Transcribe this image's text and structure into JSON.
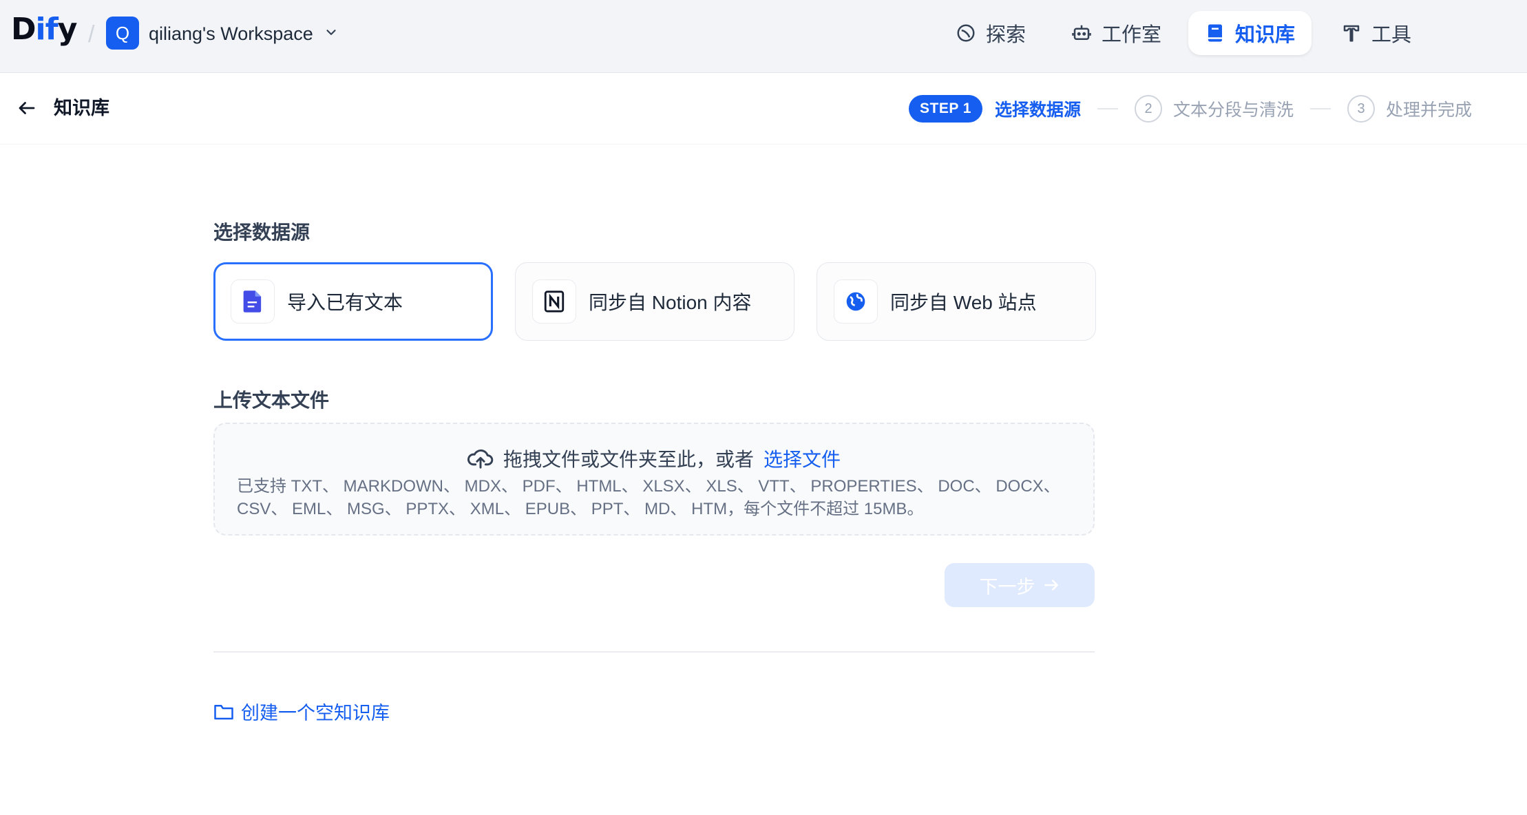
{
  "app": {
    "logo_main": "D",
    "logo_accent": "ify",
    "logo_end": "y"
  },
  "workspace": {
    "avatar": "Q",
    "name": "qiliang's Workspace"
  },
  "nav": [
    {
      "label": "探索",
      "icon": "compass-icon"
    },
    {
      "label": "工作室",
      "icon": "robot-icon"
    },
    {
      "label": "知识库",
      "icon": "book-icon",
      "active": true
    },
    {
      "label": "工具",
      "icon": "hammer-icon"
    }
  ],
  "subheader": {
    "title": "知识库",
    "steps": [
      {
        "badge": "STEP 1",
        "label": "选择数据源",
        "active": true
      },
      {
        "badge": "2",
        "label": "文本分段与清洗"
      },
      {
        "badge": "3",
        "label": "处理并完成"
      }
    ]
  },
  "datasource": {
    "title": "选择数据源",
    "options": [
      {
        "label": "导入已有文本",
        "icon": "file-text-icon",
        "selected": true
      },
      {
        "label": "同步自 Notion 内容",
        "icon": "notion-icon"
      },
      {
        "label": "同步自 Web 站点",
        "icon": "globe-icon"
      }
    ]
  },
  "upload": {
    "title": "上传文本文件",
    "drop_text": "拖拽文件或文件夹至此，或者",
    "select_link": "选择文件",
    "formats_line1": "已支持 TXT、 MARKDOWN、 MDX、 PDF、 HTML、 XLSX、 XLS、 VTT、 PROPERTIES、 DOC、 DOCX、",
    "formats_line2": "CSV、 EML、 MSG、 PPTX、 XML、 EPUB、 PPT、 MD、 HTM，每个文件不超过 15MB。"
  },
  "next_button": "下一步",
  "create_empty": "创建一个空知识库",
  "colors": {
    "primary": "#155eef",
    "disabled_button": "#e0eaff",
    "topbar": "#f2f4f7"
  }
}
